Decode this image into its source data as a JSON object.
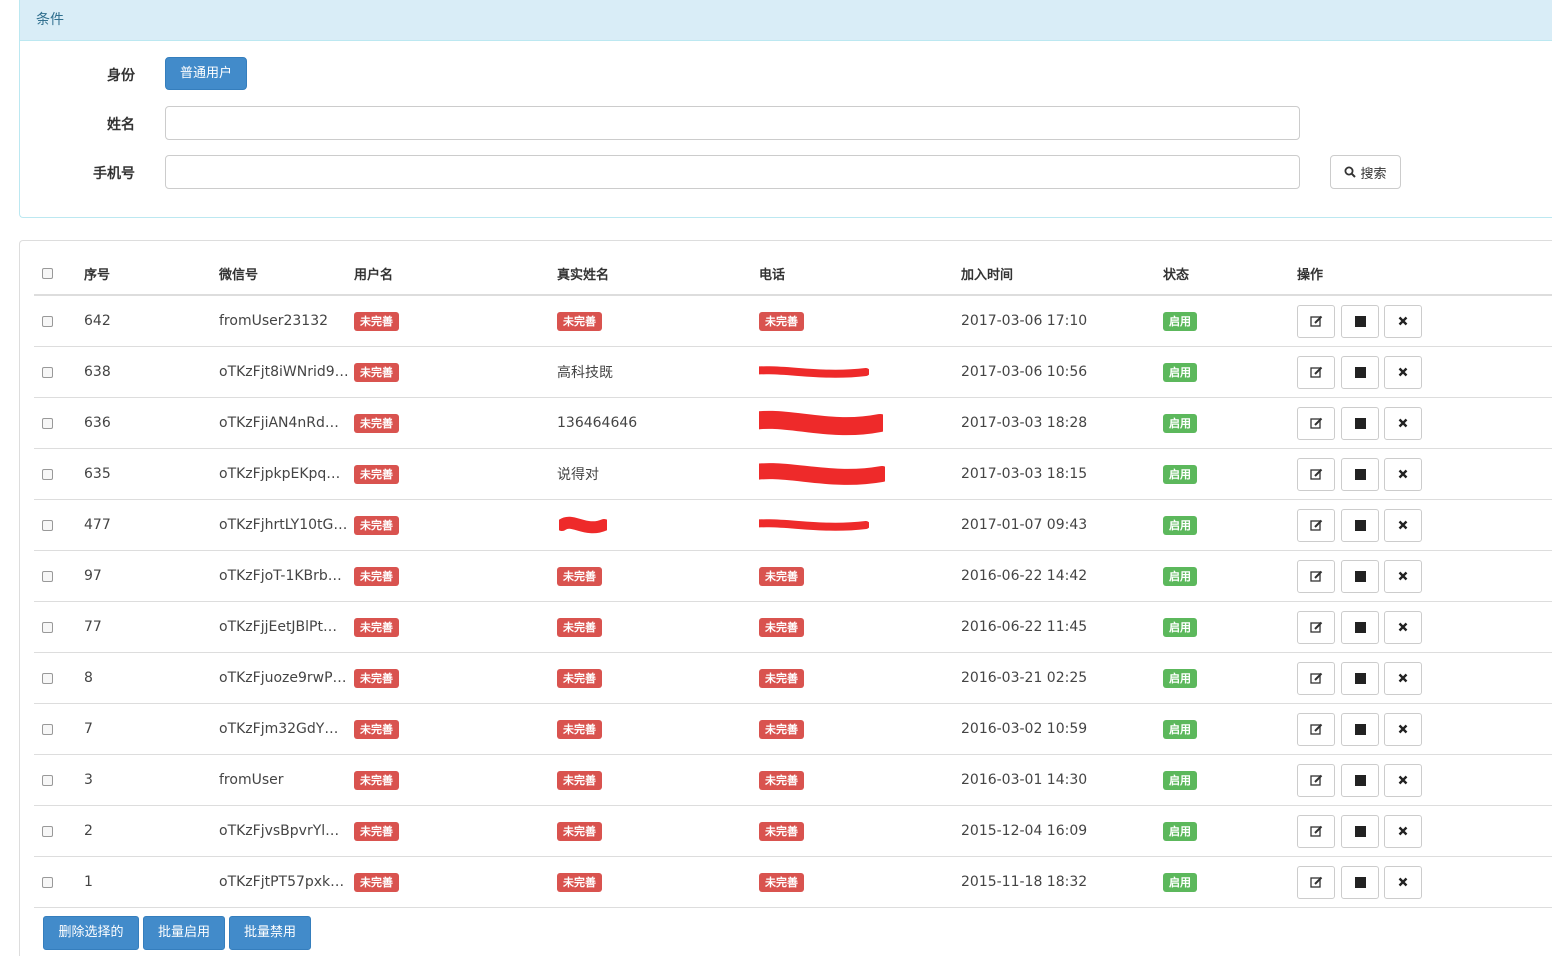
{
  "filter": {
    "heading": "条件",
    "role_label": "身份",
    "role_value": "普通用户",
    "name_label": "姓名",
    "name_value": "",
    "phone_label": "手机号",
    "phone_value": "",
    "search_label": "搜索"
  },
  "table": {
    "headers": [
      "序号",
      "微信号",
      "用户名",
      "真实姓名",
      "电话",
      "加入时间",
      "状态",
      "操作"
    ],
    "rows": [
      {
        "id": "642",
        "wechat": "fromUser23132",
        "username": "未完善",
        "realname": "未完善",
        "phone": "未完善",
        "joined": "2017-03-06 17:10",
        "status": "启用"
      },
      {
        "id": "638",
        "wechat": "oTKzFjt8iWNrid9…",
        "username": "未完善",
        "realname": "高科技既",
        "phone": "",
        "joined": "2017-03-06 10:56",
        "status": "启用"
      },
      {
        "id": "636",
        "wechat": "oTKzFjiAN4nRd…",
        "username": "未完善",
        "realname": "136464646",
        "phone": "",
        "joined": "2017-03-03 18:28",
        "status": "启用"
      },
      {
        "id": "635",
        "wechat": "oTKzFjpkpEKpq…",
        "username": "未完善",
        "realname": "说得对",
        "phone": "",
        "joined": "2017-03-03 18:15",
        "status": "启用"
      },
      {
        "id": "477",
        "wechat": "oTKzFjhrtLY10tG…",
        "username": "未完善",
        "realname": "",
        "phone": "",
        "joined": "2017-01-07 09:43",
        "status": "启用"
      },
      {
        "id": "97",
        "wechat": "oTKzFjoT-1KBrb…",
        "username": "未完善",
        "realname": "未完善",
        "phone": "未完善",
        "joined": "2016-06-22 14:42",
        "status": "启用"
      },
      {
        "id": "77",
        "wechat": "oTKzFjjEetJBlPt…",
        "username": "未完善",
        "realname": "未完善",
        "phone": "未完善",
        "joined": "2016-06-22 11:45",
        "status": "启用"
      },
      {
        "id": "8",
        "wechat": "oTKzFjuoze9rwP…",
        "username": "未完善",
        "realname": "未完善",
        "phone": "未完善",
        "joined": "2016-03-21 02:25",
        "status": "启用"
      },
      {
        "id": "7",
        "wechat": "oTKzFjm32GdY…",
        "username": "未完善",
        "realname": "未完善",
        "phone": "未完善",
        "joined": "2016-03-02 10:59",
        "status": "启用"
      },
      {
        "id": "3",
        "wechat": "fromUser",
        "username": "未完善",
        "realname": "未完善",
        "phone": "未完善",
        "joined": "2016-03-01 14:30",
        "status": "启用"
      },
      {
        "id": "2",
        "wechat": "oTKzFjvsBpvrYl…",
        "username": "未完善",
        "realname": "未完善",
        "phone": "未完善",
        "joined": "2015-12-04 16:09",
        "status": "启用"
      },
      {
        "id": "1",
        "wechat": "oTKzFjtPT57pxk…",
        "username": "未完善",
        "realname": "未完善",
        "phone": "未完善",
        "joined": "2015-11-18 18:32",
        "status": "启用"
      }
    ]
  },
  "bulk_actions": {
    "delete_selected": "删除选择的",
    "bulk_enable": "批量启用",
    "bulk_disable": "批量禁用"
  },
  "colors": {
    "primary": "#428bca",
    "danger": "#d9534f",
    "success": "#5cb85c",
    "info_bg": "#d9edf7",
    "redaction": "#ee2a2a"
  },
  "icons": {
    "search": "search-icon",
    "edit": "edit-icon",
    "stop": "stop-icon",
    "delete": "close-icon"
  }
}
